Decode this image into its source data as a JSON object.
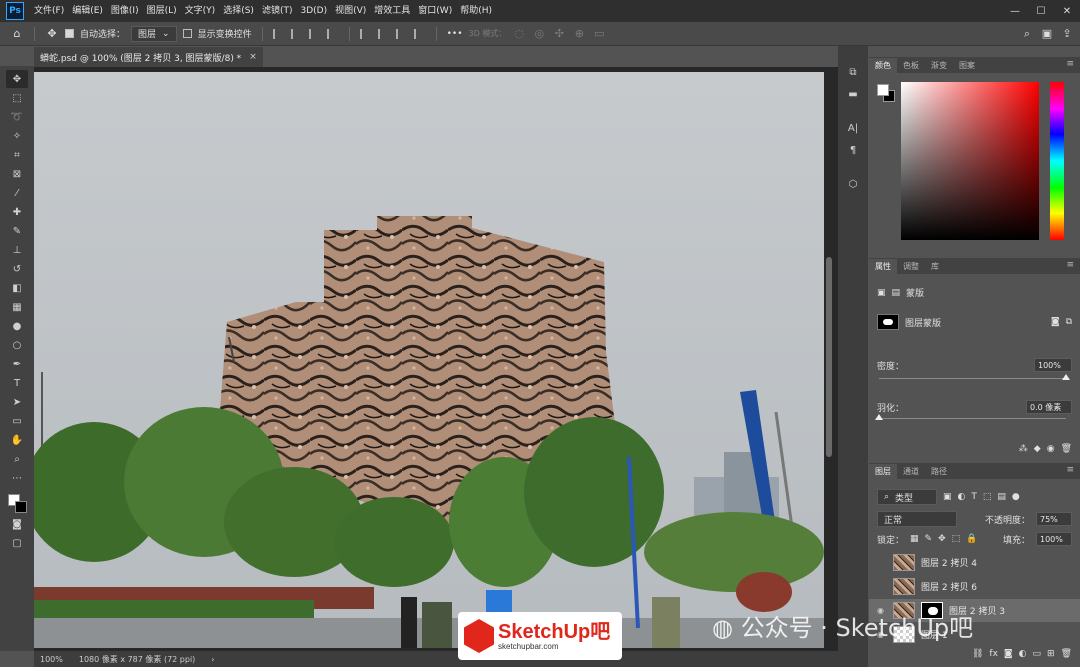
{
  "app": {
    "logo": "Ps"
  },
  "menu": [
    "文件(F)",
    "编辑(E)",
    "图像(I)",
    "图层(L)",
    "文字(Y)",
    "选择(S)",
    "滤镜(T)",
    "3D(D)",
    "视图(V)",
    "增效工具",
    "窗口(W)",
    "帮助(H)"
  ],
  "window_controls": {
    "minimize": "—",
    "maximize": "☐",
    "close": "✕"
  },
  "options": {
    "auto_select_label": "自动选择：",
    "auto_select_target": "图层",
    "show_transform_label": "显示变换控件",
    "more_label": "•••",
    "mode_label": "3D 模式："
  },
  "document_tab": {
    "title": "蟒蛇.psd @ 100% (图层 2 拷贝 3, 图层蒙版/8) *",
    "close": "×"
  },
  "status": {
    "zoom": "100%",
    "dimensions": "1080 像素 x 787 像素 (72 ppi)"
  },
  "color_panel": {
    "tabs": [
      "颜色",
      "色板",
      "渐变",
      "图案"
    ],
    "active": 0,
    "foreground": "#ffffff",
    "background": "#000000"
  },
  "properties_panel": {
    "tabs": [
      "属性",
      "调整",
      "库"
    ],
    "section_label": "蒙版",
    "mask_label": "图层蒙版",
    "density_label": "密度：",
    "density_value": "100%",
    "density_fraction": 1.0,
    "feather_label": "羽化：",
    "feather_value": "0.0 像素",
    "feather_fraction": 0.0
  },
  "layers_panel": {
    "tabs": [
      "图层",
      "通道",
      "路径"
    ],
    "filter_label": "类型",
    "blend_mode": "正常",
    "opacity_label": "不透明度：",
    "opacity_value": "75%",
    "lock_label": "锁定：",
    "fill_label": "填充：",
    "fill_value": "100%",
    "layers": [
      {
        "name": "图层 2 拷贝 4",
        "visible": false,
        "mask": false,
        "selected": false
      },
      {
        "name": "图层 2 拷贝 6",
        "visible": false,
        "mask": false,
        "selected": false
      },
      {
        "name": "图层 2 拷贝 3",
        "visible": true,
        "mask": true,
        "selected": true
      },
      {
        "name": "图层 1",
        "visible": true,
        "mask": false,
        "selected": false
      }
    ]
  },
  "watermark": {
    "wechat_text": "公众号 · SketchUp吧",
    "brand_name": "SketchUp吧",
    "brand_url": "sketchupbar.com"
  },
  "colors": {
    "accent": "#31a8ff",
    "brand": "#e1261c"
  }
}
